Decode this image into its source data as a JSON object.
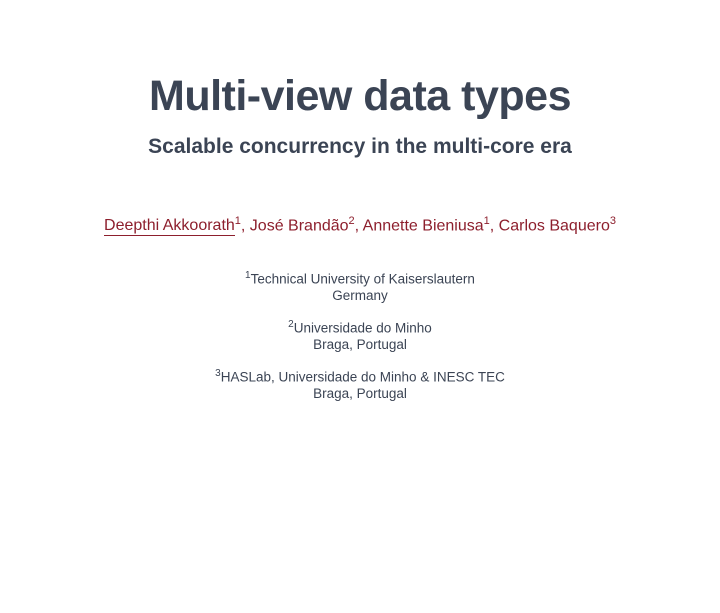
{
  "title": "Multi-view data types",
  "subtitle": "Scalable concurrency in the multi-core era",
  "authors": [
    {
      "name": "Deepthi Akkoorath",
      "aff": "1",
      "presenter": true
    },
    {
      "name": "José Brandão",
      "aff": "2",
      "presenter": false
    },
    {
      "name": "Annette Bieniusa",
      "aff": "1",
      "presenter": false
    },
    {
      "name": "Carlos Baquero",
      "aff": "3",
      "presenter": false
    }
  ],
  "affiliations": [
    {
      "num": "1",
      "line1": "Technical University of Kaiserslautern",
      "line2": "Germany"
    },
    {
      "num": "2",
      "line1": "Universidade do Minho",
      "line2": "Braga, Portugal"
    },
    {
      "num": "3",
      "line1": "HASLab, Universidade do Minho & INESC TEC",
      "line2": "Braga, Portugal"
    }
  ]
}
